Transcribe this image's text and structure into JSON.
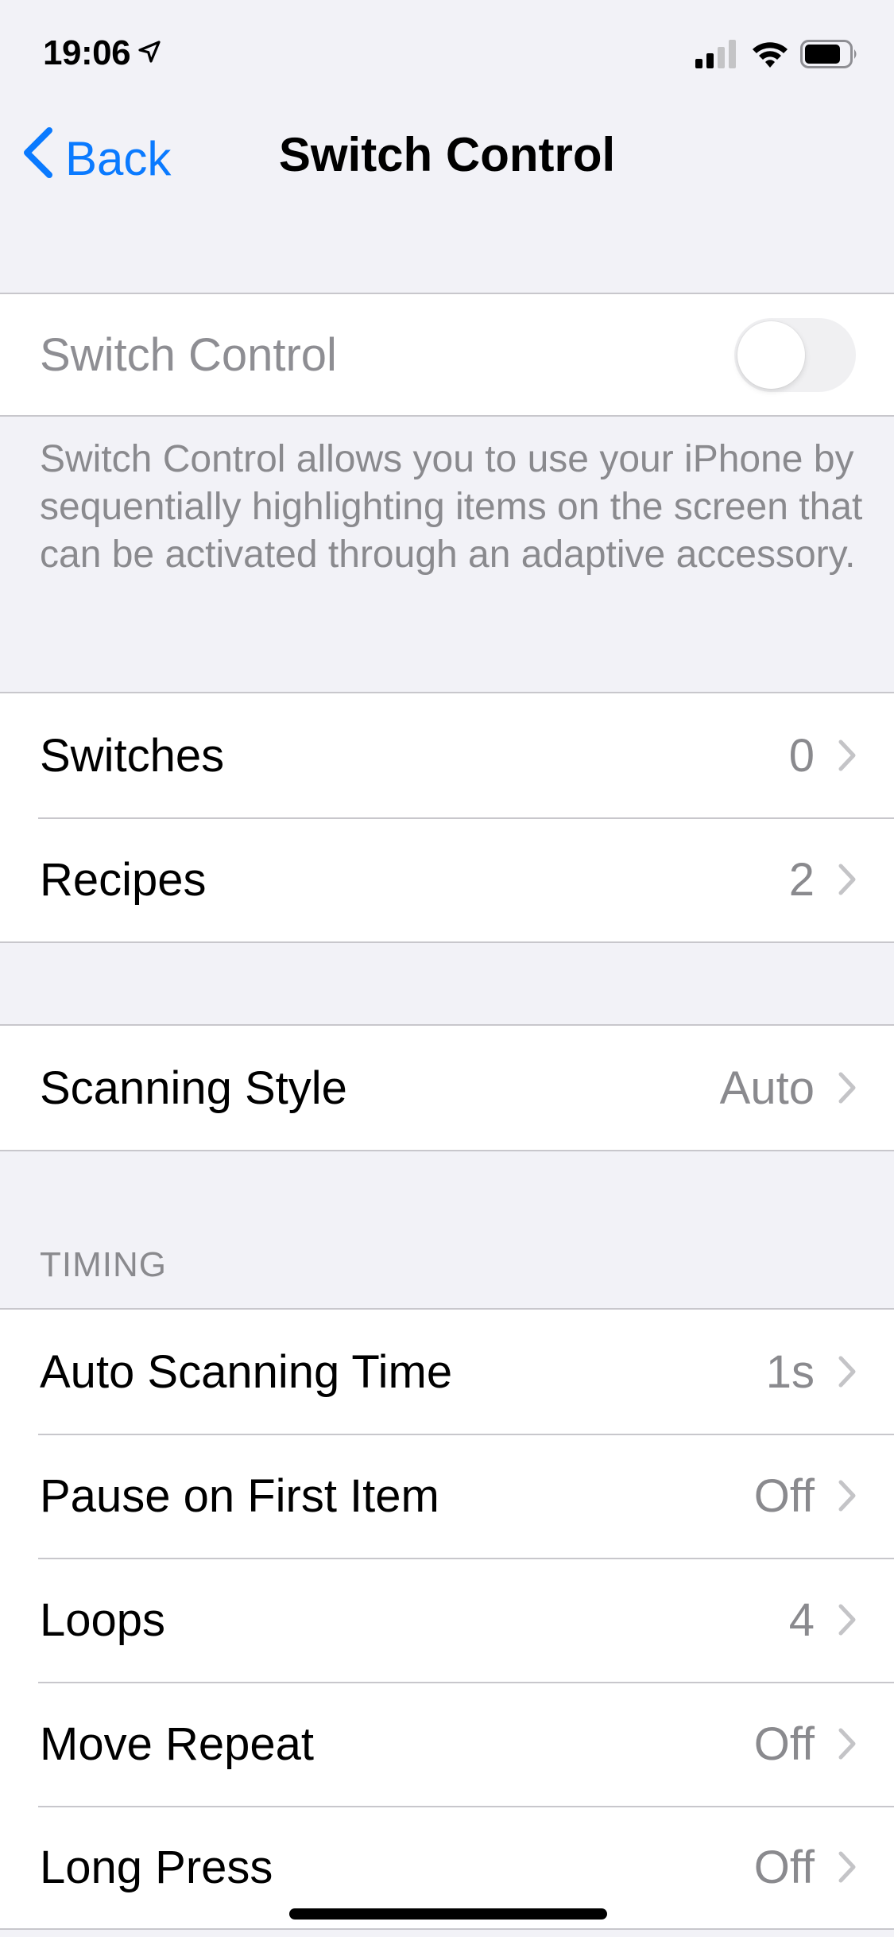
{
  "status_bar": {
    "time": "19:06",
    "location_icon": "location-arrow-icon",
    "signal_icon": "cellular-signal-icon",
    "signal_bars_active": 2,
    "signal_bars_total": 4,
    "wifi_icon": "wifi-icon",
    "battery_icon": "battery-icon",
    "battery_level": 0.75
  },
  "nav": {
    "back_label": "Back",
    "back_icon": "chevron-left-icon",
    "title": "Switch Control"
  },
  "accent_color": "#0a7aff",
  "main_toggle": {
    "label": "Switch Control",
    "on": false,
    "enabled": false
  },
  "description": "Switch Control allows you to use your iPhone by sequentially highlighting items on the screen that can be activated through an adaptive accessory.",
  "group1": [
    {
      "label": "Switches",
      "value": "0"
    },
    {
      "label": "Recipes",
      "value": "2"
    }
  ],
  "group2": [
    {
      "label": "Scanning Style",
      "value": "Auto"
    }
  ],
  "timing": {
    "header": "TIMING",
    "items": [
      {
        "label": "Auto Scanning Time",
        "value": "1s"
      },
      {
        "label": "Pause on First Item",
        "value": "Off"
      },
      {
        "label": "Loops",
        "value": "4"
      },
      {
        "label": "Move Repeat",
        "value": "Off"
      },
      {
        "label": "Long Press",
        "value": "Off"
      }
    ]
  }
}
